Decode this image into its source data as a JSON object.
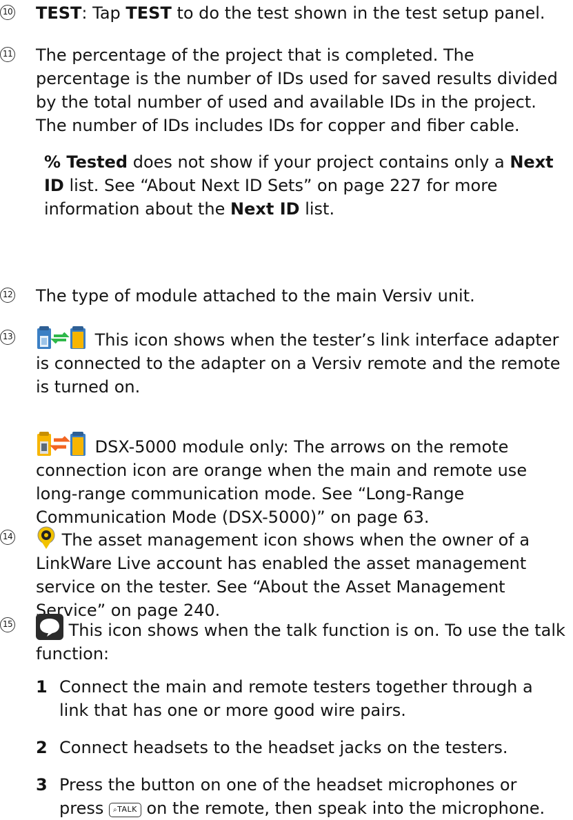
{
  "items": {
    "i10": {
      "marker": "10",
      "label": "TEST",
      "text1": ": Tap ",
      "bold2": "TEST",
      "text2": " to do the test shown in the test setup panel."
    },
    "i11": {
      "marker": "11",
      "para1": "The percentage of the project that is completed. The percentage is the number of IDs used for saved results divided by the total number of used and available IDs in the project. The number of IDs includes IDs for copper and fiber cable.",
      "p2_bold1": "% Tested",
      "p2_text1": " does not show if your project contains only a ",
      "p2_bold2": "Next ID",
      "p2_text2": " list. See “About Next ID Sets” on page 227 for more information about the ",
      "p2_bold3": "Next ID",
      "p2_text3": " list."
    },
    "i12": {
      "marker": "12",
      "text": "The type of module attached to the main Versiv unit."
    },
    "i13": {
      "marker": "13",
      "para1": " This icon shows when the tester’s link interface adapter is connected to the adapter on a Versiv remote and the remote is turned on.",
      "para2": " DSX-5000 module only: The arrows on the remote connection icon are orange when the main and remote use long-range communication mode. See “Long-Range Communication Mode (DSX-5000)” on page 63."
    },
    "i14": {
      "marker": "14",
      "text": " The asset management icon shows when the owner of a LinkWare Live account has enabled the asset management service on the tester. See “About the Asset Management Service” on page 240."
    },
    "i15": {
      "marker": "15",
      "text": " This icon shows when the talk function is on. To use the talk function:",
      "steps": [
        {
          "num": "1",
          "text": "Connect the main and remote testers together through a link that has one or more good wire pairs."
        },
        {
          "num": "2",
          "text": "Connect headsets to the headset jacks on the testers."
        },
        {
          "num": "3",
          "text_before": "Press the button on one of the headset microphones or press ",
          "key": "TALK",
          "text_after": " on the remote, then speak into the microphone."
        }
      ]
    }
  },
  "colors": {
    "connect_arrows": "#2fb84a",
    "long_range_arrows": "#f26522",
    "device_blue": "#3b7fc4",
    "device_yellow": "#f7b500",
    "asset_yellow": "#f2c200"
  },
  "icons": [
    "remote-connected-icon",
    "remote-long-range-icon",
    "asset-management-icon",
    "talk-icon",
    "talk-key-icon"
  ]
}
